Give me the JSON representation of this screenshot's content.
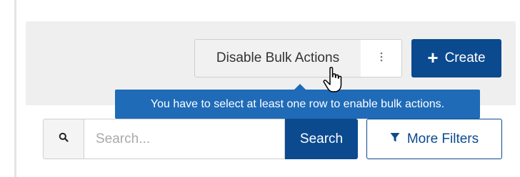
{
  "toolbar": {
    "disable_bulk_label": "Disable Bulk Actions",
    "kebab_icon": "more-vertical-icon",
    "create_label": "Create",
    "create_icon": "plus-icon"
  },
  "tooltip": {
    "text": "You have to select at least one row to enable bulk actions."
  },
  "search": {
    "icon": "search-icon",
    "placeholder": "Search...",
    "value": "",
    "button_label": "Search"
  },
  "filters": {
    "button_label": "More Filters",
    "icon": "filter-icon"
  },
  "colors": {
    "primary": "#0b4a8f",
    "tooltip": "#1f6bb8",
    "header_bg": "#efefef"
  }
}
